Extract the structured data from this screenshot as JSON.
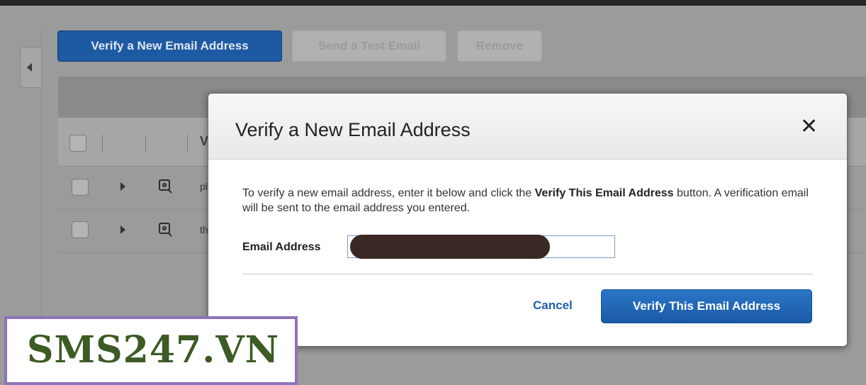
{
  "toolbar": {
    "verify_new_label": "Verify a New Email Address",
    "send_test_label": "Send a Test Email",
    "remove_label": "Remove"
  },
  "table": {
    "header_partial": "V",
    "rows": [
      {
        "text": "pl"
      },
      {
        "text": "th"
      }
    ]
  },
  "modal": {
    "title": "Verify a New Email Address",
    "close_glyph": "✕",
    "desc_before": "To verify a new email address, enter it below and click the ",
    "desc_bold": "Verify This Email Address",
    "desc_after": " button. A verification email will be sent to the email address you entered.",
    "email_label": "Email Address",
    "email_value": "",
    "cancel_label": "Cancel",
    "verify_label": "Verify This Email Address"
  },
  "watermark": {
    "text": "SMS247.VN"
  },
  "colors": {
    "primary_button": "#1d5aa3",
    "verify_button": "#2b76c6",
    "cancel_link": "#1f5fa8",
    "watermark_text": "#3d5b24",
    "watermark_border": "#8f72ba"
  },
  "icons": [
    "chevron-left-icon",
    "expand-arrow-icon",
    "magnifier-icon",
    "close-icon"
  ]
}
